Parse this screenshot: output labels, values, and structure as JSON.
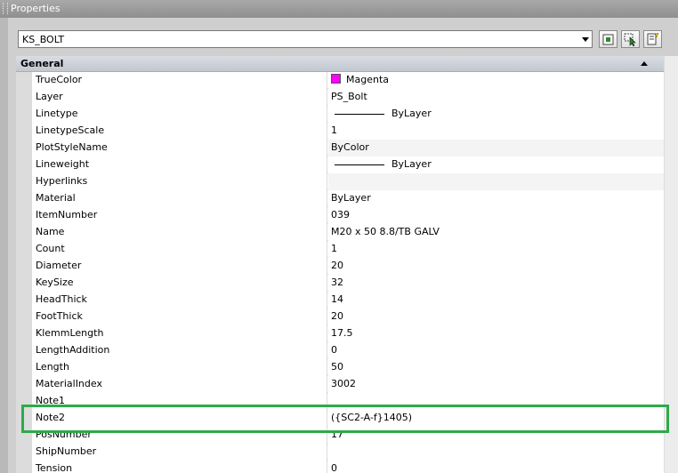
{
  "window": {
    "title": "Properties"
  },
  "selector": {
    "value": "KS_BOLT"
  },
  "toolbar": {
    "buttons": [
      {
        "name": "toggle-pickadd-button",
        "icon": "pickadd-icon"
      },
      {
        "name": "select-objects-button",
        "icon": "select-objects-icon"
      },
      {
        "name": "quick-select-button",
        "icon": "quick-select-icon"
      }
    ]
  },
  "group": {
    "label": "General"
  },
  "colors": {
    "truecolor_swatch": "#ff00ff",
    "highlight": "#2eaa4a"
  },
  "properties": [
    {
      "name": "TrueColor",
      "value": "Magenta",
      "kind": "color"
    },
    {
      "name": "Layer",
      "value": "PS_Bolt"
    },
    {
      "name": "Linetype",
      "value": "ByLayer",
      "kind": "linetype"
    },
    {
      "name": "LinetypeScale",
      "value": "1"
    },
    {
      "name": "PlotStyleName",
      "value": "ByColor",
      "readonly": true
    },
    {
      "name": "Lineweight",
      "value": "ByLayer",
      "kind": "linetype"
    },
    {
      "name": "Hyperlinks",
      "value": "",
      "readonly": true
    },
    {
      "name": "Material",
      "value": "ByLayer"
    },
    {
      "name": "ItemNumber",
      "value": "039"
    },
    {
      "name": "Name",
      "value": "M20 x 50 8.8/TB GALV"
    },
    {
      "name": "Count",
      "value": "1"
    },
    {
      "name": "Diameter",
      "value": "20"
    },
    {
      "name": "KeySize",
      "value": "32"
    },
    {
      "name": "HeadThick",
      "value": "14"
    },
    {
      "name": "FootThick",
      "value": "20"
    },
    {
      "name": "KlemmLength",
      "value": "17.5"
    },
    {
      "name": "LengthAddition",
      "value": "0"
    },
    {
      "name": "Length",
      "value": "50"
    },
    {
      "name": "MaterialIndex",
      "value": "3002"
    },
    {
      "name": "Note1",
      "value": ""
    },
    {
      "name": "Note2",
      "value": "({SC2-A-f}1405)"
    },
    {
      "name": "PosNumber",
      "value": "17"
    },
    {
      "name": "ShipNumber",
      "value": ""
    },
    {
      "name": "Tension",
      "value": "0"
    }
  ]
}
